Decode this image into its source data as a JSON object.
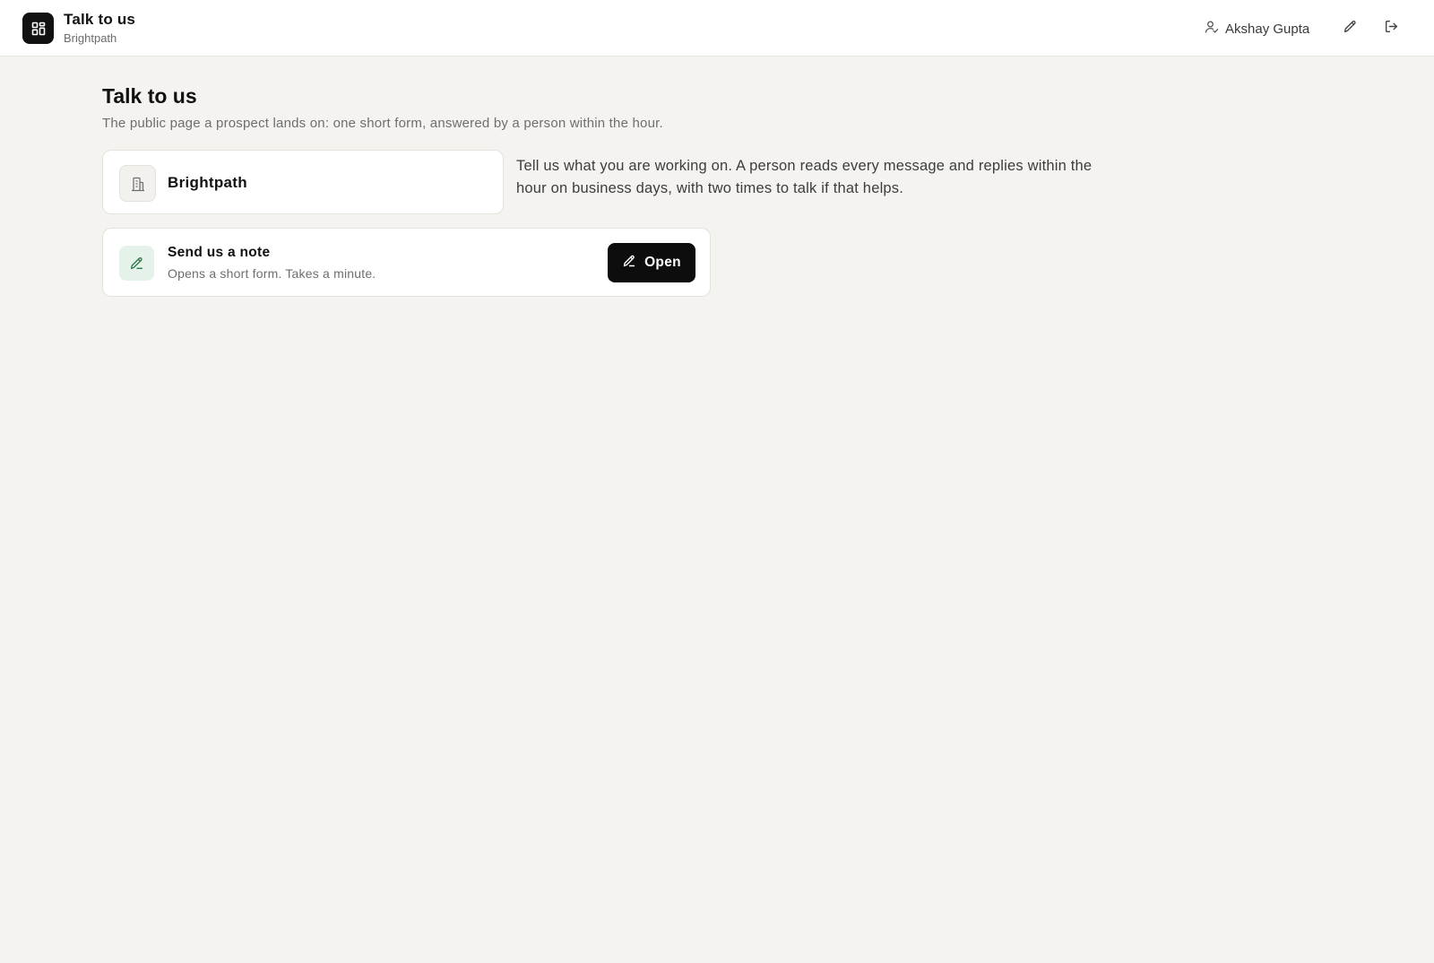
{
  "header": {
    "app_title": "Talk to us",
    "app_subtitle": "Brightpath",
    "app_icon": "grid-icon",
    "user_name": "Akshay Gupta",
    "user_icon": "user-icon",
    "edit_icon": "pencil-icon",
    "logout_icon": "logout-icon"
  },
  "main": {
    "title": "Talk to us",
    "subtitle": "The public page a prospect lands on: one short form, answered by a person within the hour.",
    "brand": {
      "name": "Brightpath",
      "icon": "building-icon"
    },
    "intro": "Tell us what you are working on. A person reads every message and replies within the hour on business days, with two times to talk if that helps.",
    "note_card": {
      "title": "Send us a note",
      "description": "Opens a short form. Takes a minute.",
      "icon": "pencil-icon",
      "button_label": "Open",
      "button_icon": "pencil-icon"
    }
  },
  "colors": {
    "background": "#f4f3f0",
    "primary_button": "#0d0d0d",
    "note_icon_bg": "#e5f2ea",
    "note_icon_stroke": "#2f7a4f"
  }
}
